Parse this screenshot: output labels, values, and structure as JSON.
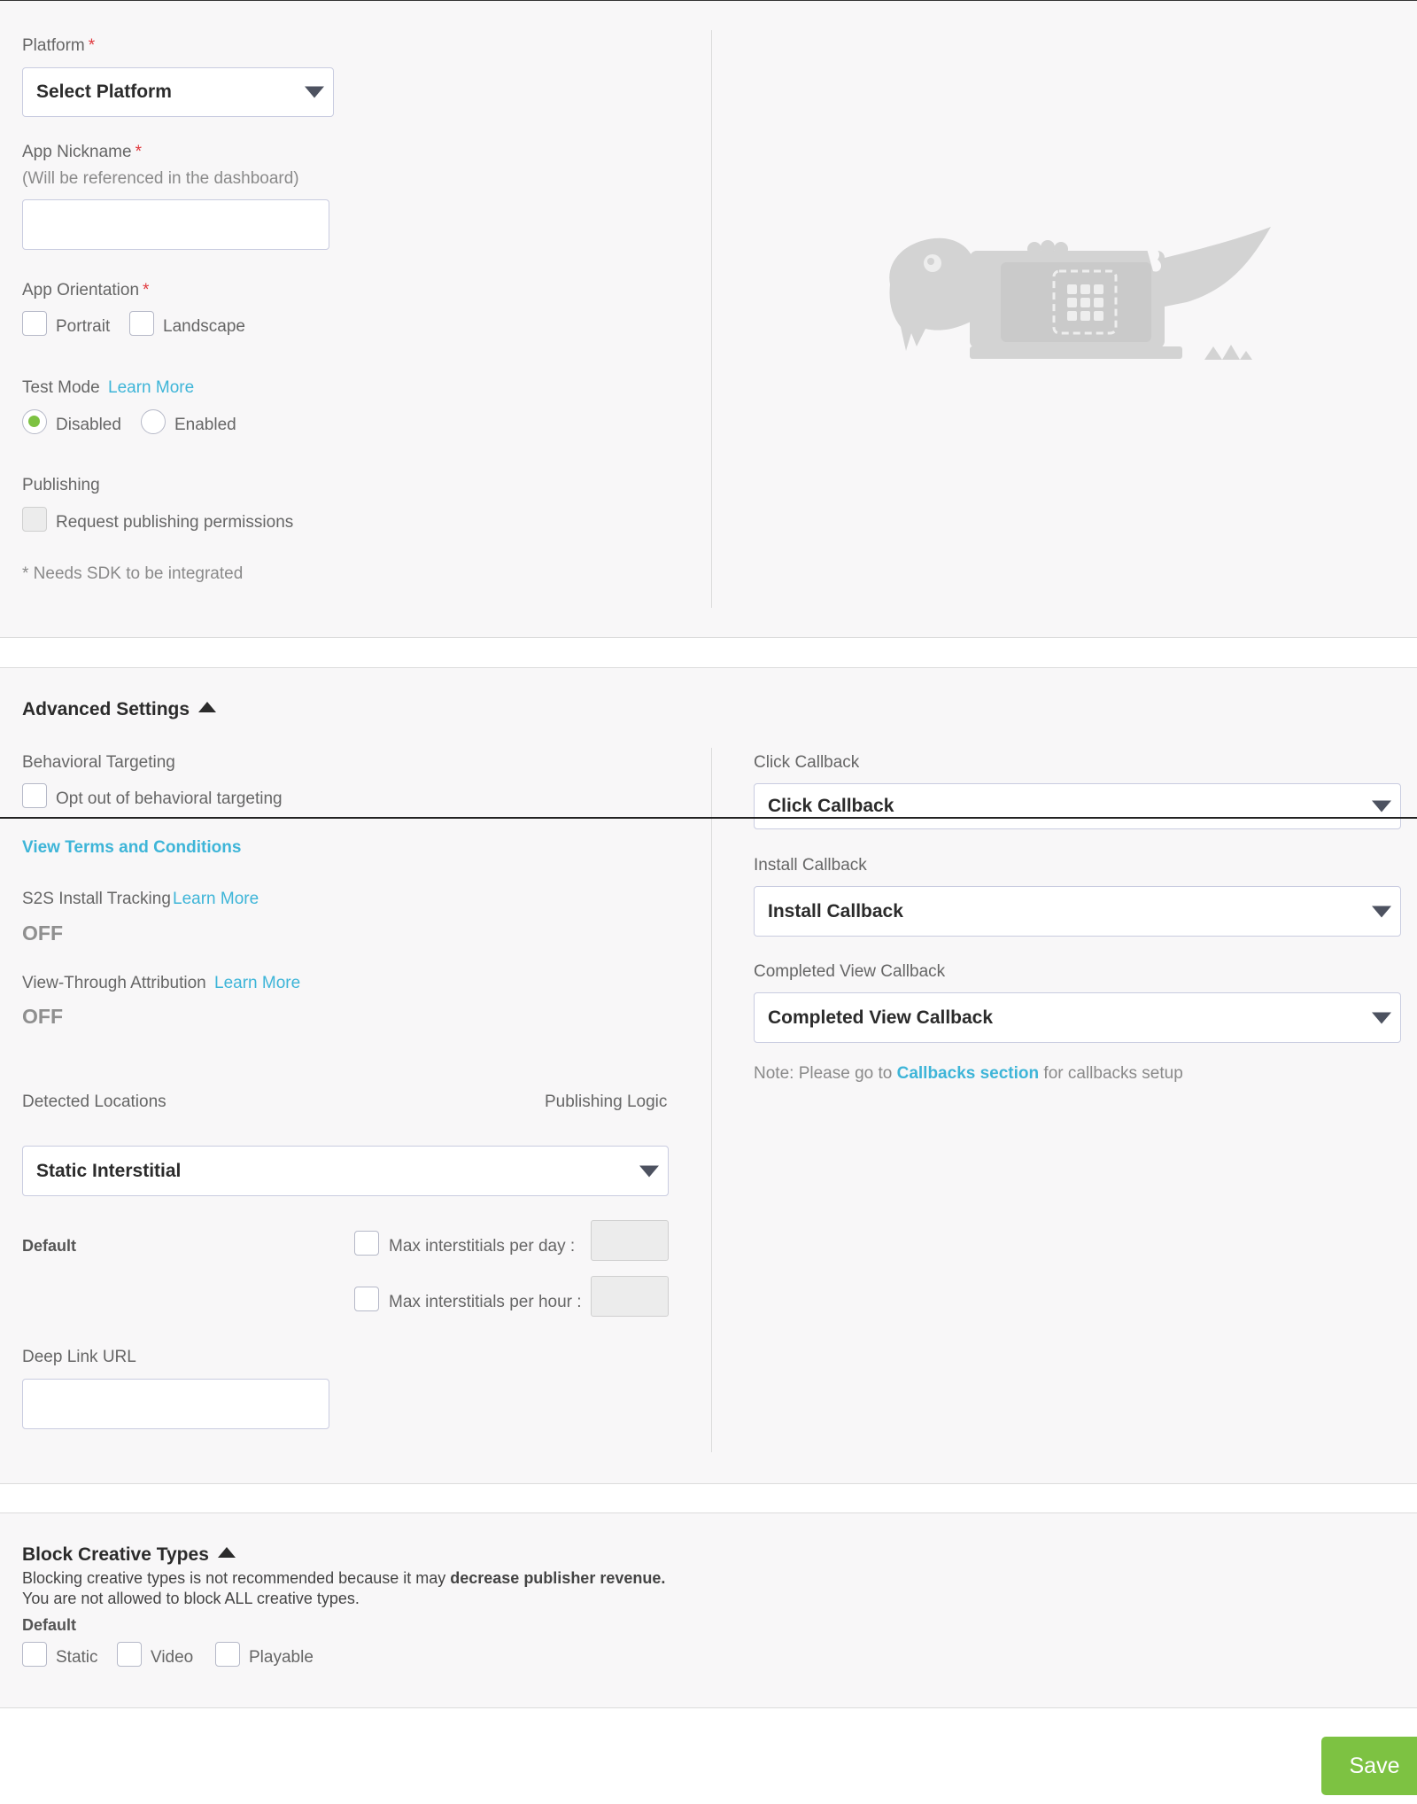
{
  "app_form": {
    "platform": {
      "label": "Platform",
      "required": "*",
      "selected": "Select Platform"
    },
    "nickname": {
      "label": "App Nickname",
      "required": "*",
      "hint": "(Will be referenced in the dashboard)",
      "value": ""
    },
    "orientation": {
      "label": "App Orientation",
      "required": "*",
      "options": [
        "Portrait",
        "Landscape"
      ]
    },
    "test_mode": {
      "label": "Test Mode",
      "learn_more": "Learn More",
      "options": [
        "Disabled",
        "Enabled"
      ],
      "selected": "Disabled"
    },
    "publishing": {
      "label": "Publishing",
      "option": "Request publishing permissions"
    },
    "sdk_note": "* Needs SDK to be integrated",
    "illustration_icon": "dinosaur-laptop-illustration"
  },
  "advanced": {
    "title": "Advanced Settings",
    "behavioral": {
      "label": "Behavioral Targeting",
      "option": "Opt out of behavioral targeting"
    },
    "terms_link": "View Terms and Conditions",
    "s2s": {
      "label": "S2S Install Tracking",
      "learn_more": "Learn More",
      "value": "OFF"
    },
    "vta": {
      "label": "View-Through Attribution",
      "learn_more": "Learn More",
      "value": "OFF"
    },
    "detected_locations": "Detected Locations",
    "publishing_logic": "Publishing Logic",
    "location_select": "Static Interstitial",
    "default_label": "Default",
    "max_per_day": "Max interstitials per day :",
    "max_per_hour": "Max interstitials per hour :",
    "deep_link": {
      "label": "Deep Link URL",
      "value": ""
    },
    "click_callback": {
      "label": "Click Callback",
      "selected": "Click Callback"
    },
    "install_callback": {
      "label": "Install Callback",
      "selected": "Install Callback"
    },
    "completed_callback": {
      "label": "Completed View Callback",
      "selected": "Completed View Callback"
    },
    "note_prefix": "Note: Please go to",
    "note_link": "Callbacks section",
    "note_suffix": "for callbacks setup"
  },
  "block_creative": {
    "title": "Block Creative Types",
    "warning_prefix": "Blocking creative types is not recommended because it may",
    "warning_bold": "decrease publisher revenue.",
    "warning_line2": "You are not allowed to block ALL creative types.",
    "default_label": "Default",
    "options": [
      "Static",
      "Video",
      "Playable"
    ]
  },
  "footer": {
    "save_label": "Save"
  },
  "colors": {
    "accent_green": "#7dc242",
    "link_blue": "#3eb5d8",
    "required_red": "#e0393e",
    "panel_bg": "#f8f7f8"
  }
}
